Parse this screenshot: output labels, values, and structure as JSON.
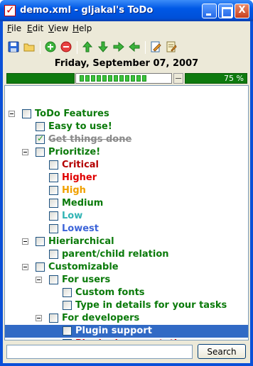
{
  "window": {
    "title": "demo.xml - gljakal's ToDo",
    "controls": {
      "minimize": "",
      "maximize": "",
      "close": "X"
    }
  },
  "menu": [
    {
      "label_first": "F",
      "label_rest": "ile"
    },
    {
      "label_first": "E",
      "label_rest": "dit"
    },
    {
      "label_first": "V",
      "label_rest": "iew"
    },
    {
      "label_first": "H",
      "label_rest": "elp"
    }
  ],
  "toolbar": {
    "icons": [
      "save-icon",
      "open-folder-icon",
      "add-icon",
      "remove-icon",
      "move-up-icon",
      "move-down-icon",
      "indent-icon",
      "outdent-icon",
      "edit-icon",
      "properties-icon"
    ]
  },
  "date": "Friday, September 07, 2007",
  "progress": {
    "percent_label": "75 %",
    "value": 0.75
  },
  "colors": {
    "green": "#0a7a0a",
    "critical": "#b40000",
    "higher": "#e00000",
    "high": "#f0a000",
    "medium": "#0a7a0a",
    "low": "#30b4b4",
    "lowest": "#3c64d8",
    "selected_bg": "#316ac5",
    "done_gray": "#8a8a8a"
  },
  "tree": [
    {
      "label": "ToDo Features",
      "level": 0,
      "expandable": true,
      "checked": false,
      "color": "green"
    },
    {
      "label": "Easy to use!",
      "level": 1,
      "expandable": false,
      "checked": false,
      "color": "green"
    },
    {
      "label": "Get things done",
      "level": 1,
      "expandable": false,
      "checked": true,
      "done": true,
      "color": "done_gray"
    },
    {
      "label": "Prioritize!",
      "level": 1,
      "expandable": true,
      "checked": false,
      "color": "green"
    },
    {
      "label": "Critical",
      "level": 2,
      "expandable": false,
      "checked": false,
      "color": "critical"
    },
    {
      "label": "Higher",
      "level": 2,
      "expandable": false,
      "checked": false,
      "color": "higher"
    },
    {
      "label": "High",
      "level": 2,
      "expandable": false,
      "checked": false,
      "color": "high"
    },
    {
      "label": "Medium",
      "level": 2,
      "expandable": false,
      "checked": false,
      "color": "medium"
    },
    {
      "label": "Low",
      "level": 2,
      "expandable": false,
      "checked": false,
      "color": "low"
    },
    {
      "label": "Lowest",
      "level": 2,
      "expandable": false,
      "checked": false,
      "color": "lowest"
    },
    {
      "label": "Hieriarchical",
      "level": 1,
      "expandable": true,
      "checked": false,
      "color": "green"
    },
    {
      "label": "parent/child relation",
      "level": 2,
      "expandable": false,
      "checked": false,
      "color": "green"
    },
    {
      "label": "Customizable",
      "level": 1,
      "expandable": true,
      "checked": false,
      "color": "green"
    },
    {
      "label": "For users",
      "level": 2,
      "expandable": true,
      "checked": false,
      "color": "green"
    },
    {
      "label": "Custom fonts",
      "level": 3,
      "expandable": false,
      "checked": false,
      "color": "green"
    },
    {
      "label": "Type in details for your tasks",
      "level": 3,
      "expandable": false,
      "checked": false,
      "color": "green"
    },
    {
      "label": "For developers",
      "level": 2,
      "expandable": true,
      "checked": false,
      "color": "green"
    },
    {
      "label": "Plugin support",
      "level": 3,
      "expandable": false,
      "checked": false,
      "color": "green",
      "selected": true
    },
    {
      "label": "Plugin documentation",
      "level": 3,
      "expandable": false,
      "checked": false,
      "color": "higher"
    }
  ],
  "search": {
    "value": "",
    "placeholder": "",
    "button_label": "Search"
  }
}
